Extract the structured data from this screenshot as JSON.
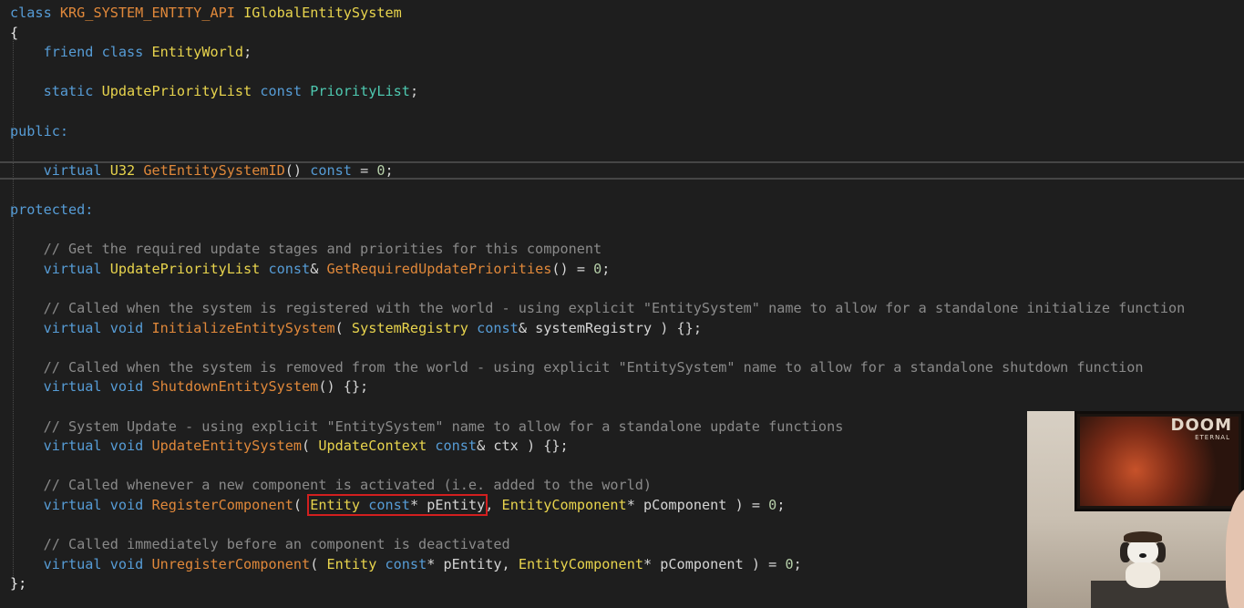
{
  "editor": {
    "language": "cpp",
    "colors": {
      "background": "#1e1e1e",
      "keyword": "#569cd6",
      "class_name": "#4ec9b0",
      "type": "#e8d44d",
      "function": "#e0883a",
      "comment": "#8a8a8a",
      "number": "#b5cea8",
      "plain": "#d4d4d4",
      "highlight_box": "#d21f1f"
    },
    "lines": [
      {
        "segments": [
          {
            "t": "class ",
            "c": "kw"
          },
          {
            "t": "KRG_SYSTEM_ENTITY_API",
            "c": "mac"
          },
          {
            "t": " ",
            "c": "pl"
          },
          {
            "t": "IGlobalEntitySystem",
            "c": "ty"
          }
        ]
      },
      {
        "segments": [
          {
            "t": "{",
            "c": "punc"
          }
        ]
      },
      {
        "segments": [
          {
            "t": "    friend ",
            "c": "kw"
          },
          {
            "t": "class ",
            "c": "kw"
          },
          {
            "t": "EntityWorld",
            "c": "ty"
          },
          {
            "t": ";",
            "c": "pl"
          }
        ]
      },
      {
        "segments": []
      },
      {
        "segments": [
          {
            "t": "    static ",
            "c": "kw"
          },
          {
            "t": "UpdatePriorityList",
            "c": "ty"
          },
          {
            "t": " const ",
            "c": "kw"
          },
          {
            "t": "PriorityList",
            "c": "cls"
          },
          {
            "t": ";",
            "c": "pl"
          }
        ]
      },
      {
        "segments": []
      },
      {
        "segments": [
          {
            "t": "public:",
            "c": "lbl"
          }
        ]
      },
      {
        "segments": []
      },
      {
        "segments": [
          {
            "t": "    virtual ",
            "c": "kw"
          },
          {
            "t": "U32",
            "c": "ty"
          },
          {
            "t": " ",
            "c": "pl"
          },
          {
            "t": "GetEntitySystemID",
            "c": "fn"
          },
          {
            "t": "() ",
            "c": "pl"
          },
          {
            "t": "const",
            "c": "kw"
          },
          {
            "t": " = ",
            "c": "pl"
          },
          {
            "t": "0",
            "c": "num"
          },
          {
            "t": ";",
            "c": "pl"
          }
        ]
      },
      {
        "segments": []
      },
      {
        "segments": [
          {
            "t": "protected:",
            "c": "lbl"
          }
        ]
      },
      {
        "segments": []
      },
      {
        "segments": [
          {
            "t": "    // Get the required update stages and priorities for this component",
            "c": "cm"
          }
        ]
      },
      {
        "segments": [
          {
            "t": "    virtual ",
            "c": "kw"
          },
          {
            "t": "UpdatePriorityList",
            "c": "ty"
          },
          {
            "t": " const",
            "c": "kw"
          },
          {
            "t": "& ",
            "c": "pl"
          },
          {
            "t": "GetRequiredUpdatePriorities",
            "c": "fn"
          },
          {
            "t": "() = ",
            "c": "pl"
          },
          {
            "t": "0",
            "c": "num"
          },
          {
            "t": ";",
            "c": "pl"
          }
        ]
      },
      {
        "segments": []
      },
      {
        "segments": [
          {
            "t": "    // Called when the system is registered with the world - using explicit \"EntitySystem\" name to allow for a standalone initialize function",
            "c": "cm"
          }
        ]
      },
      {
        "segments": [
          {
            "t": "    virtual void ",
            "c": "kw"
          },
          {
            "t": "InitializeEntitySystem",
            "c": "fn"
          },
          {
            "t": "( ",
            "c": "pl"
          },
          {
            "t": "SystemRegistry",
            "c": "ty"
          },
          {
            "t": " const",
            "c": "kw"
          },
          {
            "t": "& systemRegistry ) {};",
            "c": "pl"
          }
        ]
      },
      {
        "segments": []
      },
      {
        "segments": [
          {
            "t": "    // Called when the system is removed from the world - using explicit \"EntitySystem\" name to allow for a standalone shutdown function",
            "c": "cm"
          }
        ]
      },
      {
        "segments": [
          {
            "t": "    virtual void ",
            "c": "kw"
          },
          {
            "t": "ShutdownEntitySystem",
            "c": "fn"
          },
          {
            "t": "() {};",
            "c": "pl"
          }
        ]
      },
      {
        "segments": []
      },
      {
        "segments": [
          {
            "t": "    // System Update - using explicit \"EntitySystem\" name to allow for a standalone update functions",
            "c": "cm"
          }
        ]
      },
      {
        "segments": [
          {
            "t": "    virtual void ",
            "c": "kw"
          },
          {
            "t": "UpdateEntitySystem",
            "c": "fn"
          },
          {
            "t": "( ",
            "c": "pl"
          },
          {
            "t": "UpdateContext",
            "c": "ty"
          },
          {
            "t": " const",
            "c": "kw"
          },
          {
            "t": "& ctx ) {};",
            "c": "pl"
          }
        ]
      },
      {
        "segments": []
      },
      {
        "segments": [
          {
            "t": "    // Called whenever a new component is activated (i.e. added to the world)",
            "c": "cm"
          }
        ]
      },
      {
        "segments": [
          {
            "t": "    virtual void ",
            "c": "kw"
          },
          {
            "t": "RegisterComponent",
            "c": "fn"
          },
          {
            "t": "( ",
            "c": "pl"
          },
          {
            "t": "Entity",
            "c": "ty",
            "hl_start": true
          },
          {
            "t": " const",
            "c": "kw"
          },
          {
            "t": "* pEntity",
            "c": "pl",
            "hl_end": true
          },
          {
            "t": ", ",
            "c": "pl"
          },
          {
            "t": "EntityComponent",
            "c": "ty"
          },
          {
            "t": "* pComponent ) = ",
            "c": "pl"
          },
          {
            "t": "0",
            "c": "num"
          },
          {
            "t": ";",
            "c": "pl"
          }
        ]
      },
      {
        "segments": []
      },
      {
        "segments": [
          {
            "t": "    // Called immediately before an component is deactivated",
            "c": "cm"
          }
        ]
      },
      {
        "segments": [
          {
            "t": "    virtual void ",
            "c": "kw"
          },
          {
            "t": "UnregisterComponent",
            "c": "fn"
          },
          {
            "t": "( ",
            "c": "pl"
          },
          {
            "t": "Entity",
            "c": "ty"
          },
          {
            "t": " const",
            "c": "kw"
          },
          {
            "t": "* pEntity, ",
            "c": "pl"
          },
          {
            "t": "EntityComponent",
            "c": "ty"
          },
          {
            "t": "* pComponent ) = ",
            "c": "pl"
          },
          {
            "t": "0",
            "c": "num"
          },
          {
            "t": ";",
            "c": "pl"
          }
        ]
      },
      {
        "segments": [
          {
            "t": "};",
            "c": "punc"
          }
        ]
      }
    ]
  },
  "webcam": {
    "poster_title": "DOOM",
    "poster_subtitle": "ETERNAL"
  }
}
